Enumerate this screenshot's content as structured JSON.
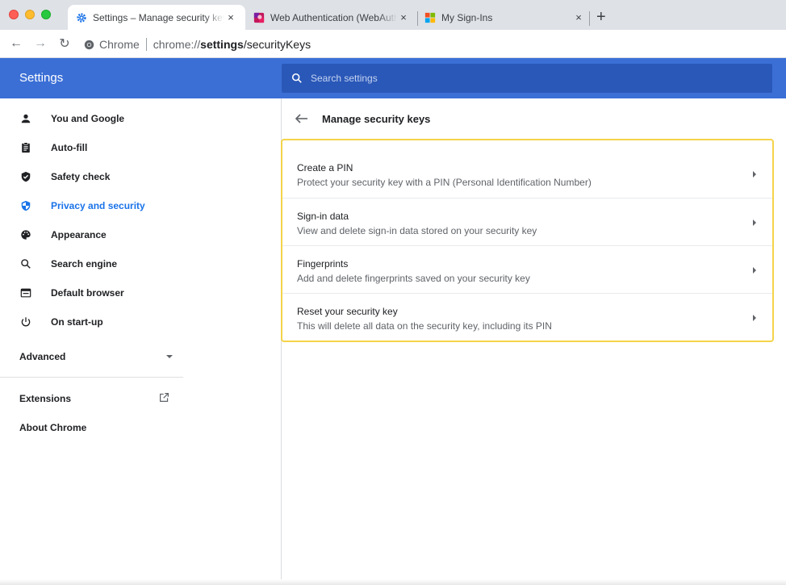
{
  "browser": {
    "tabs": [
      {
        "title": "Settings – Manage security keys",
        "close": "×",
        "active": true
      },
      {
        "title": "Web Authentication (WebAuthn",
        "close": "×",
        "active": false
      },
      {
        "title": "My Sign-Ins",
        "close": "×",
        "active": false
      }
    ],
    "new_tab": "+",
    "chip_label": "Chrome",
    "url_host": "chrome://",
    "url_bold": "settings",
    "url_path": "/securityKeys"
  },
  "header": {
    "title": "Settings",
    "search_placeholder": "Search settings"
  },
  "sidebar": {
    "items": [
      {
        "label": "You and Google",
        "icon": "person-icon"
      },
      {
        "label": "Auto-fill",
        "icon": "clipboard-icon"
      },
      {
        "label": "Safety check",
        "icon": "shield-check-icon"
      },
      {
        "label": "Privacy and security",
        "icon": "shield-half-icon",
        "selected": true
      },
      {
        "label": "Appearance",
        "icon": "palette-icon"
      },
      {
        "label": "Search engine",
        "icon": "search-icon"
      },
      {
        "label": "Default browser",
        "icon": "browser-window-icon"
      },
      {
        "label": "On start-up",
        "icon": "power-icon"
      }
    ],
    "advanced": "Advanced",
    "extensions": "Extensions",
    "about": "About Chrome"
  },
  "main": {
    "title": "Manage security keys",
    "rows": [
      {
        "title": "Create a PIN",
        "description": "Protect your security key with a PIN (Personal Identification Number)"
      },
      {
        "title": "Sign-in data",
        "description": "View and delete sign-in data stored on your security key"
      },
      {
        "title": "Fingerprints",
        "description": "Add and delete fingerprints saved on your security key"
      },
      {
        "title": "Reset your security key",
        "description": "This will delete all data on the security key, including its PIN"
      }
    ]
  },
  "colors": {
    "header_blue": "#3b6fd6",
    "search_blue": "#2a58b8",
    "selected_blue": "#1a73e8",
    "highlight_yellow": "#f4d34a"
  }
}
